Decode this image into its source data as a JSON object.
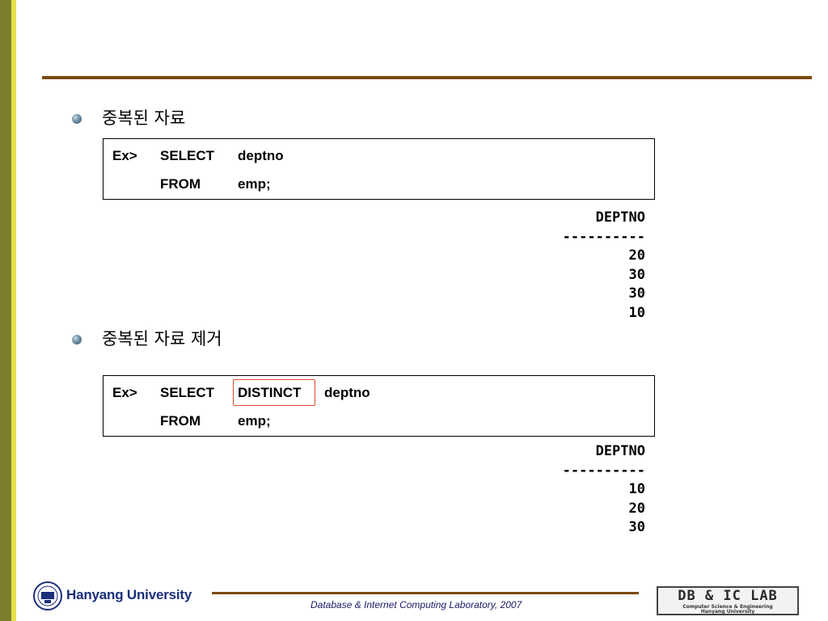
{
  "section1": {
    "heading": "중복된 자료",
    "code": {
      "prefix": "Ex>",
      "select_kw": "SELECT",
      "select_col": "deptno",
      "from_kw": "FROM",
      "from_table": "emp;"
    },
    "result": {
      "header": "DEPTNO",
      "separator": "----------",
      "rows": [
        "20",
        "30",
        "30",
        "10"
      ]
    }
  },
  "section2": {
    "heading": "중복된 자료 제거",
    "code": {
      "prefix": "Ex>",
      "select_kw": "SELECT",
      "distinct_kw": "DISTINCT",
      "select_col": "deptno",
      "from_kw": "FROM",
      "from_table": "emp;"
    },
    "result": {
      "header": "DEPTNO",
      "separator": "----------",
      "rows": [
        "10",
        "20",
        "30"
      ]
    }
  },
  "footer": {
    "university": "Hanyang University",
    "caption": "Database & Internet Computing Laboratory, 2007",
    "lab_title": "DB & IC LAB",
    "lab_sub1": "Computer Science & Engineering",
    "lab_sub2": "Hanyang University"
  },
  "colors": {
    "accent_rule": "#7a4a10",
    "highlight": "#d94a2a",
    "sidebar": "#7e7d2c"
  }
}
